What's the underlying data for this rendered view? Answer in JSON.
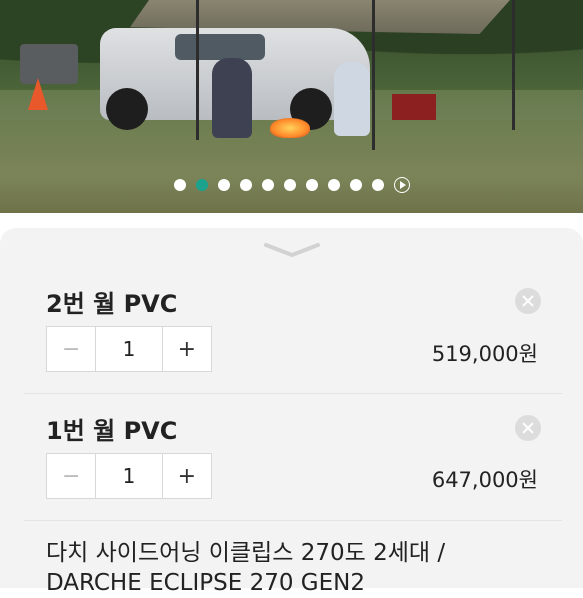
{
  "carousel": {
    "total_dots": 10,
    "active_index": 1,
    "play_icon": "play-icon"
  },
  "options": [
    {
      "name": "2번 월 PVC",
      "quantity": "1",
      "price": "519,000원",
      "minus": "−",
      "plus": "+"
    },
    {
      "name": "1번 월 PVC",
      "quantity": "1",
      "price": "647,000원",
      "minus": "−",
      "plus": "+"
    }
  ],
  "product": {
    "name_line1": "다치 사이드어닝 이클립스 270도 2세대 /",
    "name_line2": "DARCHE ECLIPSE 270 GEN2"
  },
  "colors": {
    "accent": "#1aa28e"
  }
}
